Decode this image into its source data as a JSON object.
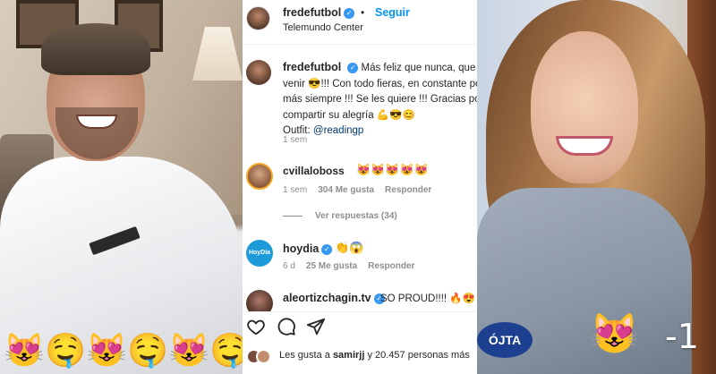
{
  "left_photo": {
    "emojis": "😻🤤😻🤤😻🤤"
  },
  "post": {
    "header": {
      "username": "fredefutbol",
      "verified_mark": "✓",
      "separator": "•",
      "follow_label": "Seguir",
      "location": "Telemundo Center"
    },
    "caption": {
      "username": "fredefutbol",
      "text": "Más feliz que nunca, que por venir 😎!!! Con todo fieras, en constante por más siempre !!! Se les quiere !!! Gracias por compartir su alegría 💪😎😊",
      "outfit_label": "Outfit:",
      "outfit_mention": "@readingp",
      "time": "1 sem"
    },
    "comments": [
      {
        "username": "cvillaloboss",
        "text": "😻😻😻😻😻",
        "time": "1 sem",
        "likes": "304 Me gusta",
        "reply_label": "Responder",
        "view_replies": "Ver respuestas (34)"
      },
      {
        "username": "hoydia",
        "avatar_text": "HoyDía",
        "text": "👏😱",
        "time": "6 d",
        "likes": "25 Me gusta",
        "reply_label": "Responder"
      },
      {
        "username": "aleortizchagin.tv",
        "text": "SO PROUD!!!! 🔥😍"
      }
    ],
    "likes_summary": {
      "prefix": "Les gusta a",
      "user": "samirjj",
      "suffix": "y 20.457 personas más"
    }
  },
  "right_photo": {
    "badge_text": "ÓJTA",
    "emoji": "😻",
    "number": "-1"
  },
  "colors": {
    "link_blue": "#0095f6",
    "verified_blue": "#3897f0",
    "mention_blue": "#00376b",
    "meta_gray": "#8e8e8e",
    "text": "#262626"
  },
  "icons": [
    "heart-icon",
    "comment-icon",
    "share-icon",
    "verified-icon"
  ]
}
